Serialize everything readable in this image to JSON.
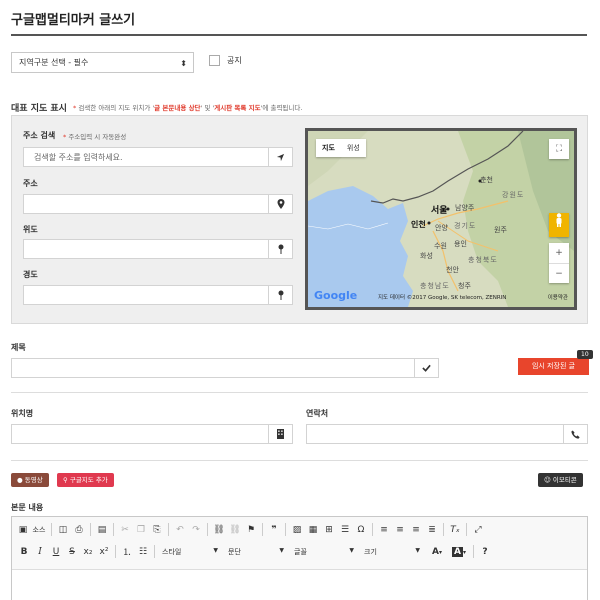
{
  "page": {
    "title": "구글맵멀티마커 글쓰기"
  },
  "region_select": {
    "value": "지역구분 선택 - 필수",
    "arrow": "⬍"
  },
  "notice": {
    "label": "공지"
  },
  "map_section": {
    "heading": "대표 지도 표시",
    "note_star": "*",
    "note_part1": " 검색한 아래의 지도 위치가 '",
    "note_emph1": "글 본문내용 상단",
    "note_part2": "' 및 '",
    "note_emph2": "게시판 목록 지도",
    "note_part3": "'에 출력됩니다."
  },
  "address": {
    "label": "주소 검색",
    "note_star": "*",
    "note": " 주소입력 시 자동완성",
    "placeholder": "검색할 주소를 입력하세요."
  },
  "fields": {
    "address_label": "주소",
    "latitude_label": "위도",
    "longitude_label": "경도"
  },
  "map": {
    "tab_map": "지도",
    "tab_satellite": "위성",
    "logo": "Google",
    "copyright": "지도 데이터 ©2017 Google, SK telecom, ZENRIN",
    "terms": "이용약관",
    "zoom_in": "+",
    "zoom_out": "−",
    "fullscreen": "⛶",
    "place_labels": [
      {
        "name": "춘천"
      },
      {
        "name": "강원도"
      },
      {
        "name": "서울"
      },
      {
        "name": "남양주"
      },
      {
        "name": "인천"
      },
      {
        "name": "안양"
      },
      {
        "name": "경기도"
      },
      {
        "name": "원주"
      },
      {
        "name": "수원"
      },
      {
        "name": "용인"
      },
      {
        "name": "화성"
      },
      {
        "name": "천안"
      },
      {
        "name": "충청북도"
      },
      {
        "name": "충청남도"
      },
      {
        "name": "청주"
      }
    ]
  },
  "subject": {
    "label": "제목"
  },
  "temp_save": {
    "label": "임시 저장된 글",
    "count": "10"
  },
  "location": {
    "label": "위치명"
  },
  "contact": {
    "label": "연락처"
  },
  "buttons": {
    "video": "동영상",
    "google_map_add": "구글지도 추가",
    "emoticon": "이모티콘"
  },
  "body": {
    "label": "본문 내용"
  },
  "toolbar": {
    "source": "소스",
    "style": "스타일",
    "paragraph": "문단",
    "font": "글꼴",
    "size": "크기"
  },
  "colors": {
    "accent_red": "#e8452c",
    "tag_brown": "#8a4a3a",
    "tag_red": "#e0394f",
    "dark": "#333333"
  }
}
